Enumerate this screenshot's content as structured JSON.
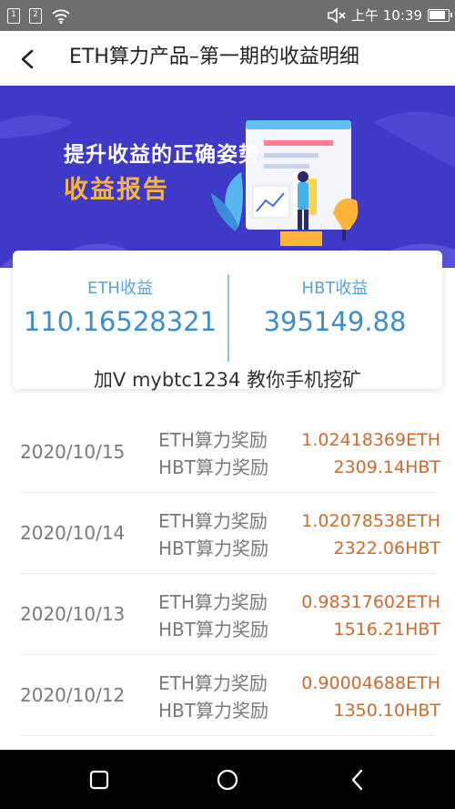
{
  "status_bar": {
    "sim1": "1",
    "sim2": "2",
    "time": "上午 10:39"
  },
  "nav": {
    "title": "ETH算力产品–第一期的收益明细"
  },
  "banner": {
    "line1": "提升收益的正确姿势",
    "line2": "收益报告",
    "bg_color": "#3f39c7",
    "accent_color": "#f6b63a"
  },
  "summary": {
    "eth_label": "ETH收益",
    "eth_value": "110.16528321",
    "hbt_label": "HBT收益",
    "hbt_value": "395149.88",
    "note": "加V mybtc1234 教你手机挖矿"
  },
  "records": [
    {
      "date": "2020/10/15",
      "eth_type": "ETH算力奖励",
      "hbt_type": "HBT算力奖励",
      "eth_amount": "1.02418369ETH",
      "hbt_amount": "2309.14HBT"
    },
    {
      "date": "2020/10/14",
      "eth_type": "ETH算力奖励",
      "hbt_type": "HBT算力奖励",
      "eth_amount": "1.02078538ETH",
      "hbt_amount": "2322.06HBT"
    },
    {
      "date": "2020/10/13",
      "eth_type": "ETH算力奖励",
      "hbt_type": "HBT算力奖励",
      "eth_amount": "0.98317602ETH",
      "hbt_amount": "1516.21HBT"
    },
    {
      "date": "2020/10/12",
      "eth_type": "ETH算力奖励",
      "hbt_type": "HBT算力奖励",
      "eth_amount": "0.90004688ETH",
      "hbt_amount": "1350.10HBT"
    }
  ],
  "colors": {
    "amount": "#cf6a2e",
    "summary_value": "#3c8ed0"
  }
}
